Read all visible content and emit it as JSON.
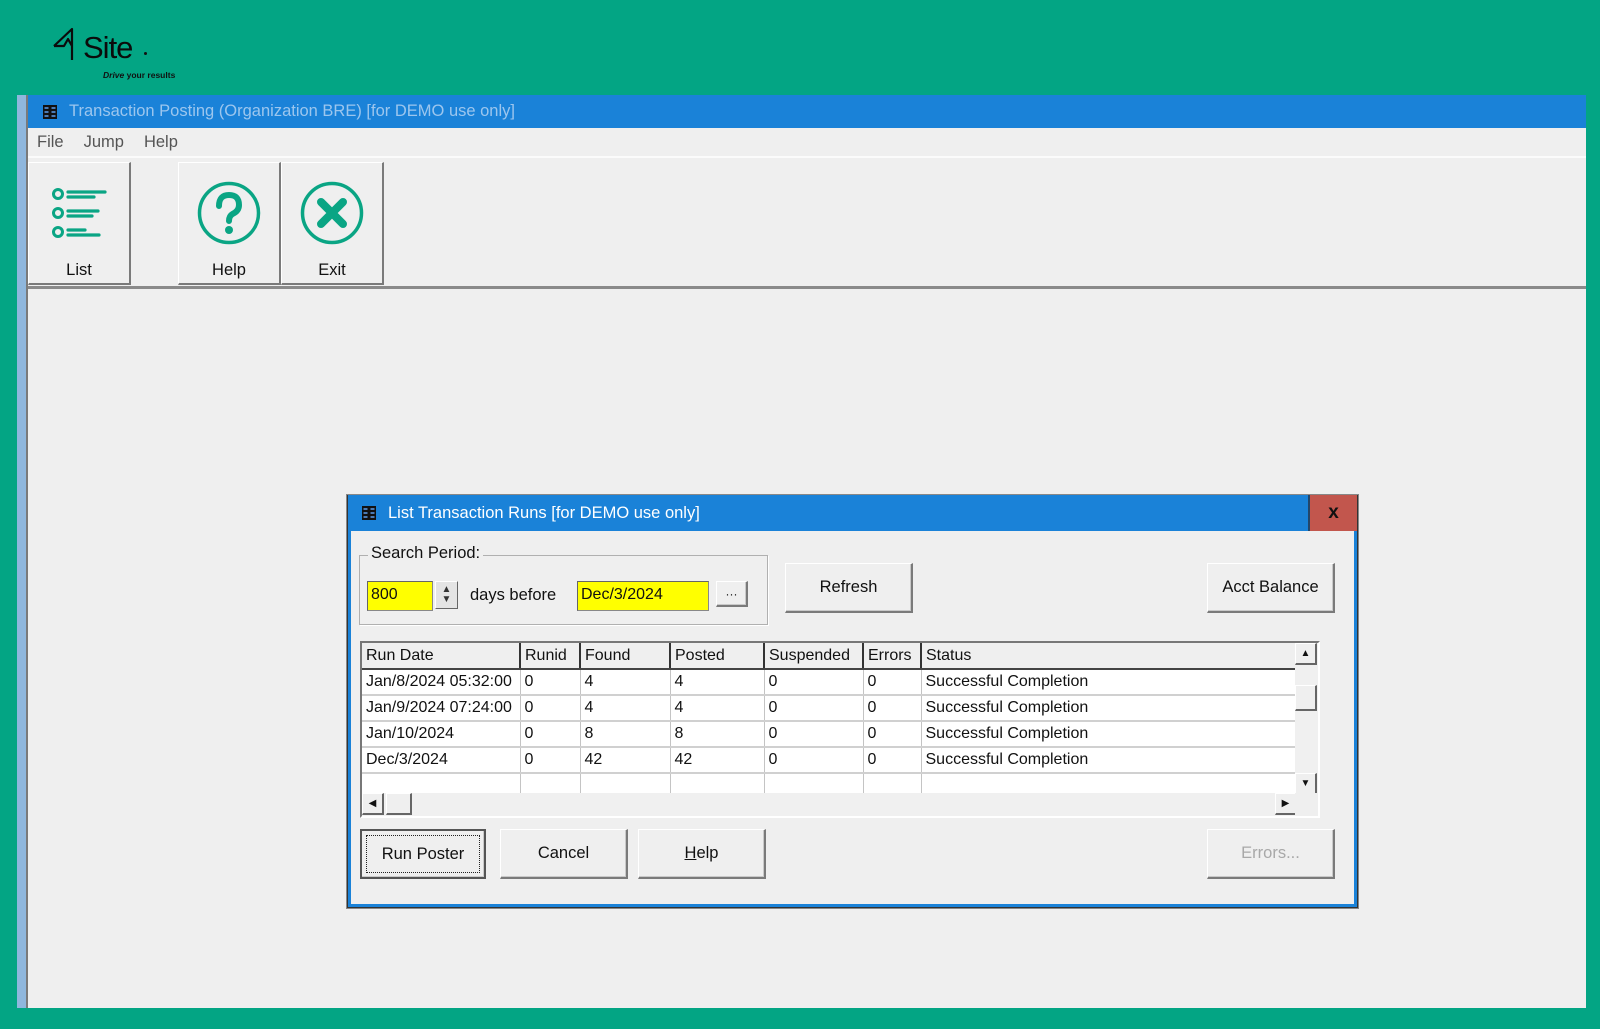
{
  "brand": {
    "name": "Site",
    "tagline_em": "Drive",
    "tagline_rest": "your results",
    "colors": {
      "background": "#03a584",
      "accent": "#0aa584",
      "titlebar": "#1a82d8",
      "close": "#c2564d",
      "field_highlight": "#ffff00"
    }
  },
  "main_window": {
    "title": "Transaction Posting (Organization BRE) [for DEMO use only]",
    "icon": "window-grid-icon",
    "menu": [
      "File",
      "Jump",
      "Help"
    ],
    "toolbar": [
      {
        "label": "List",
        "icon": "list-icon"
      },
      {
        "label": "Help",
        "icon": "help-circle-icon"
      },
      {
        "label": "Exit",
        "icon": "exit-circle-icon"
      }
    ]
  },
  "dialog": {
    "title": "List Transaction Runs [for DEMO use only]",
    "close_label": "x",
    "search_period": {
      "legend": "Search Period:",
      "days_value": "800",
      "days_label": "days before",
      "date_value": "Dec/3/2024",
      "date_picker_label": "···"
    },
    "refresh_label": "Refresh",
    "acct_balance_label": "Acct Balance",
    "table": {
      "columns": [
        "Run Date",
        "Runid",
        "Found",
        "Posted",
        "Suspended",
        "Errors",
        "Status"
      ],
      "rows": [
        [
          "Jan/8/2024 05:32:00",
          "0",
          "4",
          "4",
          "0",
          "0",
          "Successful Completion"
        ],
        [
          "Jan/9/2024 07:24:00",
          "0",
          "4",
          "4",
          "0",
          "0",
          "Successful Completion"
        ],
        [
          "Jan/10/2024",
          "0",
          "8",
          "8",
          "0",
          "0",
          "Successful Completion"
        ],
        [
          "Dec/3/2024",
          "0",
          "42",
          "42",
          "0",
          "0",
          "Successful Completion"
        ]
      ]
    },
    "buttons": {
      "run_poster": "Run Poster",
      "cancel": "Cancel",
      "help_underlined": "H",
      "help_rest": "elp",
      "errors": "Errors..."
    }
  }
}
